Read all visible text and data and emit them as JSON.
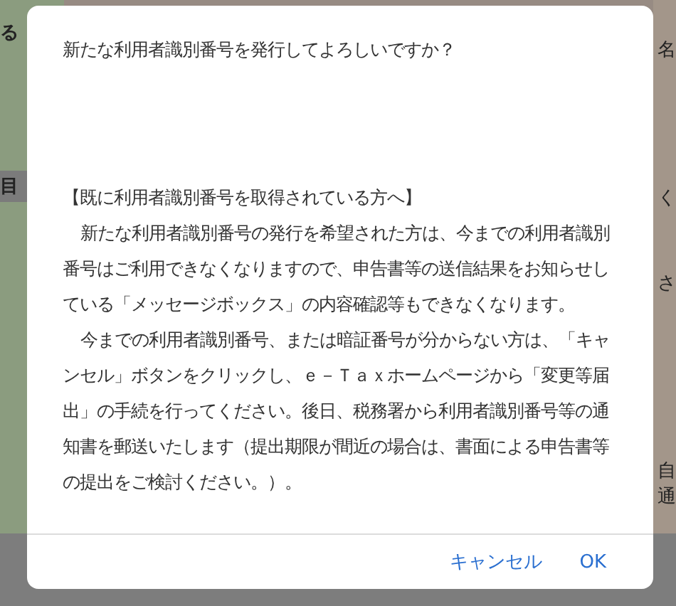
{
  "background": {
    "left_fragments": [
      "る",
      "目"
    ],
    "right_fragments": [
      "名",
      "く",
      "さ",
      "自",
      "通"
    ]
  },
  "dialog": {
    "message": "新たな利用者識別番号を発行してよろしいですか？",
    "heading": "【既に利用者識別番号を取得されている方へ】",
    "paragraphs": [
      "新たな利用者識別番号の発行を希望された方は、今までの利用者識別番号はご利用できなくなりますので、申告書等の送信結果をお知らせしている「メッセージボックス」の内容確認等もできなくなります。",
      "今までの利用者識別番号、または暗証番号が分からない方は、「キャンセル」ボタンをクリックし、ｅ－Ｔａｘホームページから「変更等届出」の手続を行ってください。後日、税務署から利用者識別番号等の通知書を郵送いたします（提出期限が間近の場合は、書面による申告書等の提出をご検討ください。）。"
    ],
    "buttons": [
      "キャンセル",
      "OK"
    ]
  }
}
